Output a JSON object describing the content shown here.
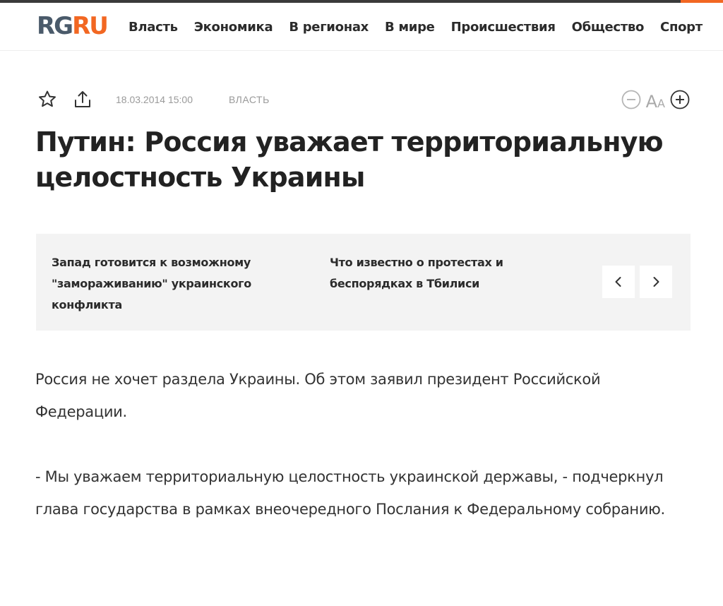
{
  "site": {
    "logo_rg": "RG",
    "logo_ru": "RU",
    "brand_colors": {
      "primary": "#4a5a6a",
      "accent": "#f26722"
    }
  },
  "nav": {
    "items": [
      "Власть",
      "Экономика",
      "В регионах",
      "В мире",
      "Происшествия",
      "Общество",
      "Спорт"
    ]
  },
  "article": {
    "date": "18.03.2014 15:00",
    "rubric": "Власть",
    "title": "Путин: Россия уважает территориальную целостность Украины",
    "icons": {
      "favorite": "star-icon",
      "share": "share-icon",
      "font_decrease": "minus-circle-icon",
      "font_size": "Aa",
      "font_increase": "plus-circle-icon"
    },
    "paragraphs": [
      "Россия не хочет раздела Украины. Об этом заявил президент Российской Федерации.",
      "- Мы уважаем территориальную целостность украинской державы, - подчеркнул глава государства в рамках внеочередного Послания к Федеральному собранию."
    ]
  },
  "related": {
    "items": [
      "Запад готовится к возможному \"замораживанию\" украинского конфликта",
      "Что известно о протестах и беспорядках в Тбилиси"
    ],
    "prev_icon": "chevron-left-icon",
    "next_icon": "chevron-right-icon"
  }
}
